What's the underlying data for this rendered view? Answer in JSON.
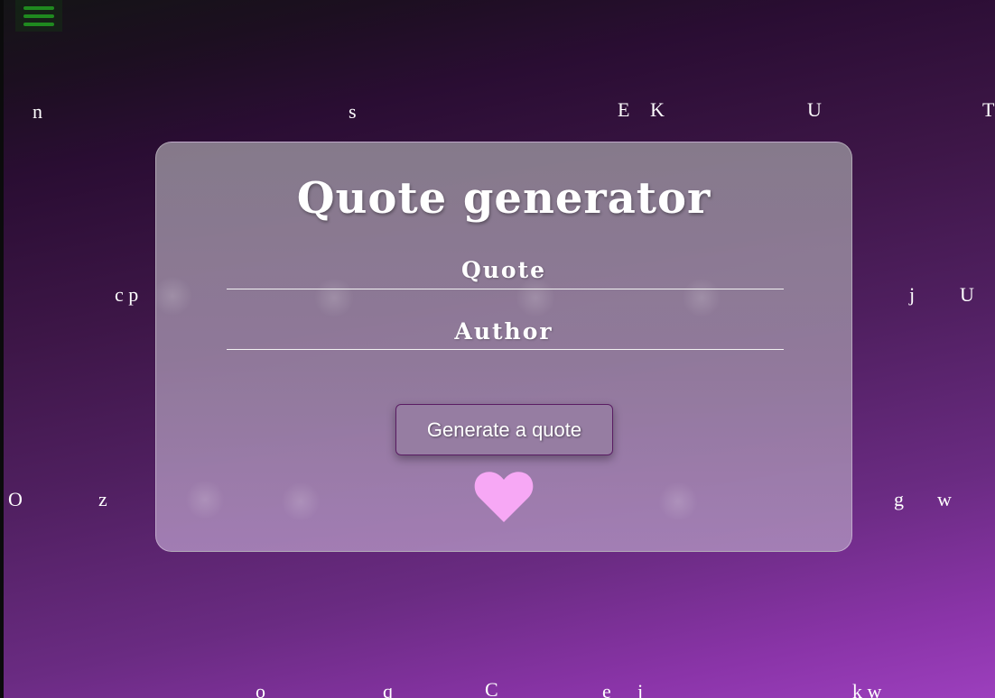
{
  "menu": {
    "icon": "hamburger-menu-icon",
    "color": "#1f8a1f"
  },
  "card": {
    "title": "Quote generator",
    "quote_label": "Quote",
    "author_label": "Author",
    "button_label": "Generate a quote",
    "heart_icon": "heart-icon",
    "heart_color": "#f7a8f5"
  },
  "background_letters": [
    "n",
    "s",
    "E",
    "K",
    "U",
    "T",
    "c p",
    "j",
    "U",
    "O",
    "z",
    "g",
    "w",
    "o",
    "q",
    "C",
    "e",
    "j",
    "k w"
  ],
  "colors": {
    "background_top": "#141416",
    "background_bottom": "#9c3fbd",
    "card": "#8c8291"
  }
}
